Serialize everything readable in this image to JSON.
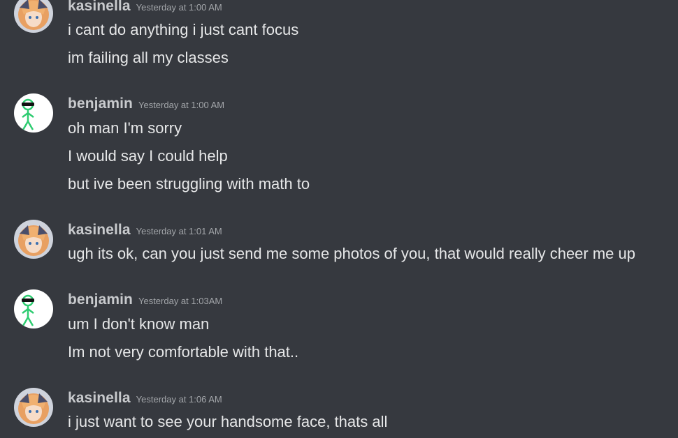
{
  "messages": [
    {
      "author": "kasinella",
      "avatar": "anime-girl-avatar",
      "timestamp": "Yesterday at 1:00 AM",
      "lines": [
        "i cant do anything i just cant focus",
        "im failing all my classes"
      ]
    },
    {
      "author": "benjamin",
      "avatar": "stick-figure-avatar",
      "timestamp": "Yesterday at 1:00 AM",
      "lines": [
        "oh man I'm sorry",
        "I would say I could help",
        "but ive been struggling with math to"
      ]
    },
    {
      "author": "kasinella",
      "avatar": "anime-girl-avatar",
      "timestamp": "Yesterday at 1:01 AM",
      "lines": [
        "ugh its ok, can you just send me some photos of you, that would really cheer me up"
      ]
    },
    {
      "author": "benjamin",
      "avatar": "stick-figure-avatar",
      "timestamp": "Yesterday at 1:03AM",
      "lines": [
        "um I don't know man",
        "Im not very comfortable with that.."
      ]
    },
    {
      "author": "kasinella",
      "avatar": "anime-girl-avatar",
      "timestamp": "Yesterday at 1:06 AM",
      "lines": [
        "i just want to see your handsome face, thats all"
      ]
    }
  ],
  "colors": {
    "background": "#36393f",
    "username": "#c8cacd",
    "timestamp": "#a3a6aa",
    "message_text": "#e6e7e8",
    "stick_figure": "#2ecc71"
  }
}
